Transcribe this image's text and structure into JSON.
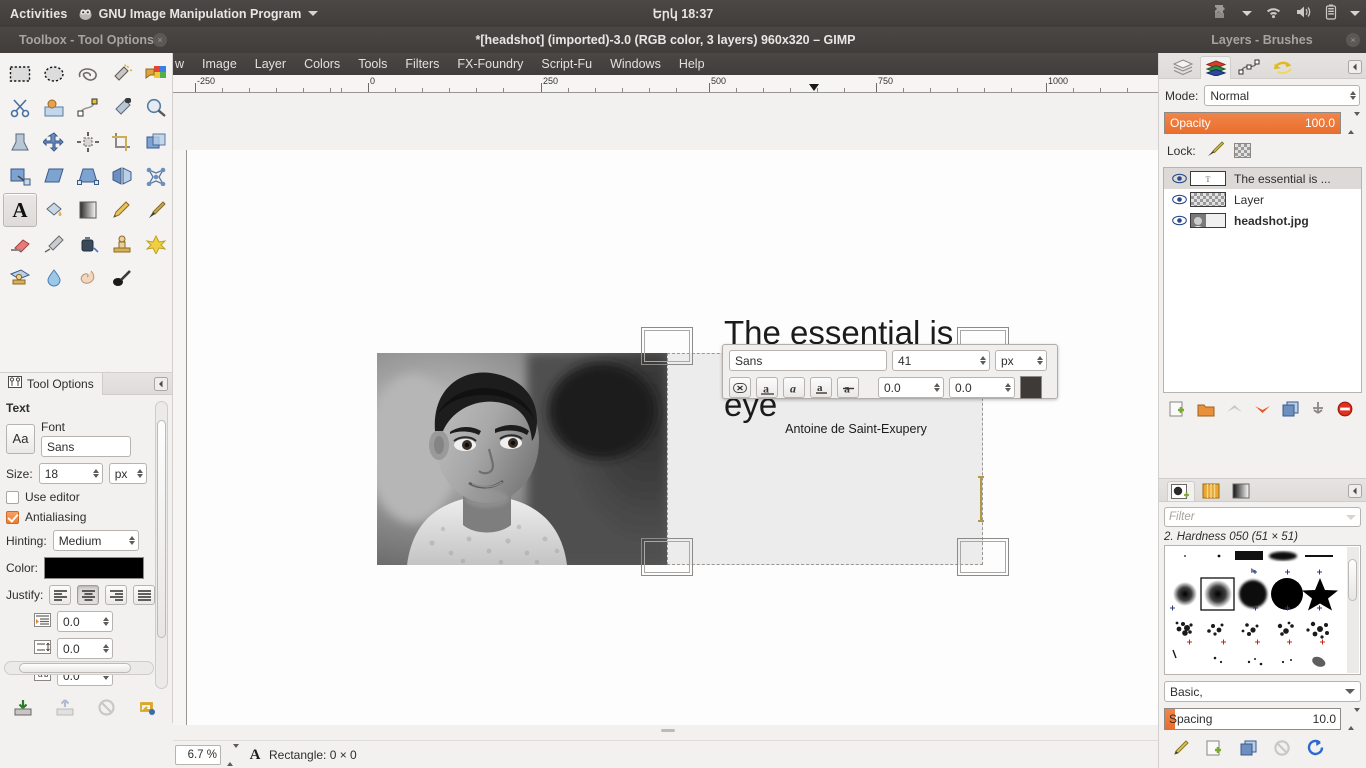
{
  "topbar": {
    "activities": "Activities",
    "app_menu": "GNU Image Manipulation Program",
    "app_menu_icon": "gimp-wilber-icon",
    "app_menu_arrow": "chevron-down-icon",
    "clock": "Երկ 18:37",
    "tray": [
      {
        "name": "puzzle-icon"
      },
      {
        "name": "chevron-down-icon"
      },
      {
        "name": "wifi-icon"
      },
      {
        "name": "volume-icon"
      },
      {
        "name": "battery-icon"
      },
      {
        "name": "chevron-down-icon"
      }
    ]
  },
  "windows": {
    "toolbox_title": "Toolbox - Tool Options",
    "image_title": "*[headshot] (imported)-3.0 (RGB color, 3 layers) 960x320 – GIMP",
    "layers_title": "Layers - Brushes",
    "close_glyph": "×"
  },
  "menubar": {
    "items": [
      "w",
      "Image",
      "Layer",
      "Colors",
      "Tools",
      "Filters",
      "FX-Foundry",
      "Script-Fu",
      "Windows",
      "Help"
    ]
  },
  "toolbox": {
    "tools": [
      {
        "name": "rect-select-tool"
      },
      {
        "name": "ellipse-select-tool"
      },
      {
        "name": "free-select-tool"
      },
      {
        "name": "fuzzy-select-tool"
      },
      {
        "name": "select-by-color-tool"
      },
      {
        "name": "scissors-select-tool"
      },
      {
        "name": "foreground-select-tool"
      },
      {
        "name": "paths-tool"
      },
      {
        "name": "color-picker-tool"
      },
      {
        "name": "zoom-tool"
      },
      {
        "name": "measure-tool"
      },
      {
        "name": "move-tool"
      },
      {
        "name": "align-tool"
      },
      {
        "name": "crop-tool"
      },
      {
        "name": "rotate-tool"
      },
      {
        "name": "scale-tool"
      },
      {
        "name": "shear-tool"
      },
      {
        "name": "perspective-tool"
      },
      {
        "name": "flip-tool"
      },
      {
        "name": "cage-transform-tool"
      },
      {
        "name": "text-tool"
      },
      {
        "name": "bucket-fill-tool"
      },
      {
        "name": "gradient-tool"
      },
      {
        "name": "pencil-tool"
      },
      {
        "name": "paintbrush-tool"
      },
      {
        "name": "eraser-tool"
      },
      {
        "name": "airbrush-tool"
      },
      {
        "name": "ink-tool"
      },
      {
        "name": "clone-tool"
      },
      {
        "name": "heal-tool"
      },
      {
        "name": "perspective-clone-tool"
      },
      {
        "name": "blur-sharpen-tool"
      },
      {
        "name": "smudge-tool"
      },
      {
        "name": "dodge-burn-tool"
      }
    ],
    "selected_tool_index": 20,
    "foreground_color": "#000000",
    "background_color": "#ffffff"
  },
  "tool_options": {
    "tab_label": "Tool Options",
    "tab_icon": "tool-options-icon",
    "collapse_icon": "collapse-left-icon",
    "section_title": "Text",
    "font_preview": "Aa",
    "font_label": "Font",
    "font_value": "Sans",
    "size_label": "Size:",
    "size_value": "18",
    "size_unit": "px",
    "use_editor_label": "Use editor",
    "use_editor_checked": false,
    "antialiasing_label": "Antialiasing",
    "antialiasing_checked": true,
    "hinting_label": "Hinting:",
    "hinting_value": "Medium",
    "color_label": "Color:",
    "color_value": "#000000",
    "justify_label": "Justify:",
    "justify_options": [
      "justify-left",
      "justify-center",
      "justify-right",
      "justify-fill"
    ],
    "justify_selected": 1,
    "indent_value": "0.0",
    "line_spacing_value": "0.0",
    "letter_spacing_value": "0.0",
    "buttons": [
      {
        "name": "save-tool-preset-button"
      },
      {
        "name": "restore-tool-preset-button"
      },
      {
        "name": "delete-tool-preset-button"
      },
      {
        "name": "reset-tool-options-button"
      }
    ]
  },
  "ruler": {
    "labels": [
      "-250",
      "0",
      "250",
      "500",
      "750",
      "1000"
    ],
    "pointer_label": "position-marker"
  },
  "canvas": {
    "photo_alt": "headshot-photo",
    "text_line1": "The essential is",
    "text_line2": "invisible to the eye",
    "author": "Antoine de Saint-Exupery"
  },
  "text_toolbar": {
    "font_value": "Sans",
    "size_value": "41",
    "size_unit": "px",
    "buttons": [
      {
        "name": "clear-style-button"
      },
      {
        "name": "bold-button"
      },
      {
        "name": "italic-button"
      },
      {
        "name": "underline-button"
      },
      {
        "name": "strikethrough-button"
      }
    ],
    "baseline_value": "0.0",
    "kerning_value": "0.0",
    "color_value": "#3d3a37"
  },
  "statusbar": {
    "zoom": "6.7 %",
    "tool_icon": "text-tool-icon",
    "message": "Rectangle: 0 × 0"
  },
  "layers_dock": {
    "tabs": [
      {
        "name": "layers-tab",
        "selected": false
      },
      {
        "name": "channels-tab",
        "selected": true
      },
      {
        "name": "paths-tab",
        "selected": false
      },
      {
        "name": "undo-history-tab",
        "selected": false
      }
    ],
    "collapse_icon": "collapse-left-icon",
    "mode_label": "Mode:",
    "mode_value": "Normal",
    "opacity_label": "Opacity",
    "opacity_value": "100.0",
    "lock_label": "Lock:",
    "lock_icons": [
      {
        "name": "lock-pixels-icon"
      },
      {
        "name": "lock-alpha-icon"
      }
    ],
    "layers": [
      {
        "name": "The essential is ...",
        "thumb": "text",
        "selected": true,
        "bold": false,
        "visible": true
      },
      {
        "name": "Layer",
        "thumb": "checker",
        "selected": false,
        "bold": false,
        "visible": true
      },
      {
        "name": "headshot.jpg",
        "thumb": "photo",
        "selected": false,
        "bold": true,
        "visible": true
      }
    ],
    "buttons": [
      {
        "name": "new-layer-button"
      },
      {
        "name": "new-layer-group-button"
      },
      {
        "name": "raise-layer-button"
      },
      {
        "name": "lower-layer-button"
      },
      {
        "name": "duplicate-layer-button"
      },
      {
        "name": "anchor-layer-button"
      },
      {
        "name": "delete-layer-button"
      }
    ]
  },
  "brushes_dock": {
    "tabs": [
      {
        "name": "brushes-tab",
        "selected": true
      },
      {
        "name": "patterns-tab",
        "selected": false
      },
      {
        "name": "gradients-tab",
        "selected": false
      }
    ],
    "collapse_icon": "collapse-left-icon",
    "filter_placeholder": "Filter",
    "filter_dropdown_icon": "chevron-down-icon",
    "brush_name": "2. Hardness 050 (51 × 51)",
    "selected_brush_index": 1,
    "tag_value": "Basic,",
    "tag_dropdown_icon": "chevron-down-icon",
    "spacing_label": "Spacing",
    "spacing_value": "10.0",
    "buttons": [
      {
        "name": "edit-brush-button"
      },
      {
        "name": "new-brush-button"
      },
      {
        "name": "duplicate-brush-button"
      },
      {
        "name": "delete-brush-button"
      },
      {
        "name": "refresh-brushes-button"
      }
    ]
  }
}
